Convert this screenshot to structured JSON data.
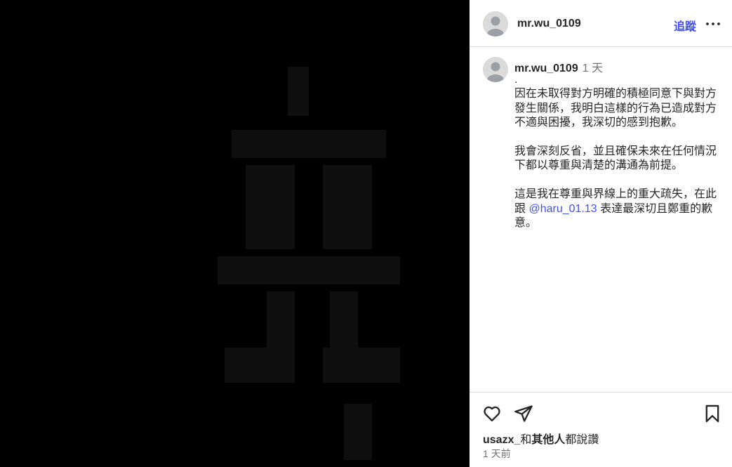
{
  "post": {
    "username": "mr.wu_0109",
    "follow_label": "追蹤"
  },
  "caption": {
    "username": "mr.wu_0109",
    "time": "1 天",
    "line0": ".",
    "para1": "因在未取得對方明確的積極同意下與對方發生關係，我明白這樣的行為已造成對方不適與困擾，我深切的感到抱歉。",
    "para2": "我會深刻反省，並且確保未來在任何情況下都以尊重與清楚的溝通為前提。",
    "para3_before": "這是我在尊重與界線上的重大疏失，在此跟 ",
    "mention": "@haru_01.13",
    "para3_after": " 表達最深切且鄭重的歉意。"
  },
  "footer": {
    "liker": "usazx_",
    "likes_mid": "和",
    "likes_others": "其他人",
    "likes_suffix": "都說讚",
    "time_ago": "1 天前"
  },
  "icons": {
    "like": "heart-icon",
    "share": "paper-plane-icon",
    "save": "bookmark-icon",
    "more": "more-horizontal-icon",
    "avatar": "default-avatar-icon"
  },
  "colors": {
    "accent": "#4150f7",
    "text": "#262626",
    "muted": "#737373",
    "media_bg": "#000000"
  }
}
